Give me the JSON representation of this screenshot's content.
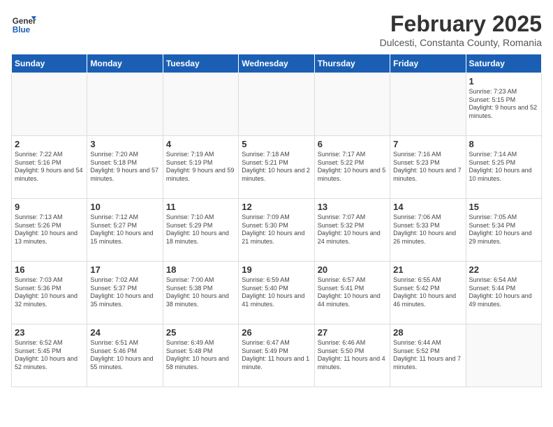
{
  "logo": {
    "general": "General",
    "blue": "Blue"
  },
  "title": "February 2025",
  "subtitle": "Dulcesti, Constanta County, Romania",
  "weekdays": [
    "Sunday",
    "Monday",
    "Tuesday",
    "Wednesday",
    "Thursday",
    "Friday",
    "Saturday"
  ],
  "weeks": [
    [
      {
        "day": "",
        "info": ""
      },
      {
        "day": "",
        "info": ""
      },
      {
        "day": "",
        "info": ""
      },
      {
        "day": "",
        "info": ""
      },
      {
        "day": "",
        "info": ""
      },
      {
        "day": "",
        "info": ""
      },
      {
        "day": "1",
        "info": "Sunrise: 7:23 AM\nSunset: 5:15 PM\nDaylight: 9 hours and 52 minutes."
      }
    ],
    [
      {
        "day": "2",
        "info": "Sunrise: 7:22 AM\nSunset: 5:16 PM\nDaylight: 9 hours and 54 minutes."
      },
      {
        "day": "3",
        "info": "Sunrise: 7:20 AM\nSunset: 5:18 PM\nDaylight: 9 hours and 57 minutes."
      },
      {
        "day": "4",
        "info": "Sunrise: 7:19 AM\nSunset: 5:19 PM\nDaylight: 9 hours and 59 minutes."
      },
      {
        "day": "5",
        "info": "Sunrise: 7:18 AM\nSunset: 5:21 PM\nDaylight: 10 hours and 2 minutes."
      },
      {
        "day": "6",
        "info": "Sunrise: 7:17 AM\nSunset: 5:22 PM\nDaylight: 10 hours and 5 minutes."
      },
      {
        "day": "7",
        "info": "Sunrise: 7:16 AM\nSunset: 5:23 PM\nDaylight: 10 hours and 7 minutes."
      },
      {
        "day": "8",
        "info": "Sunrise: 7:14 AM\nSunset: 5:25 PM\nDaylight: 10 hours and 10 minutes."
      }
    ],
    [
      {
        "day": "9",
        "info": "Sunrise: 7:13 AM\nSunset: 5:26 PM\nDaylight: 10 hours and 13 minutes."
      },
      {
        "day": "10",
        "info": "Sunrise: 7:12 AM\nSunset: 5:27 PM\nDaylight: 10 hours and 15 minutes."
      },
      {
        "day": "11",
        "info": "Sunrise: 7:10 AM\nSunset: 5:29 PM\nDaylight: 10 hours and 18 minutes."
      },
      {
        "day": "12",
        "info": "Sunrise: 7:09 AM\nSunset: 5:30 PM\nDaylight: 10 hours and 21 minutes."
      },
      {
        "day": "13",
        "info": "Sunrise: 7:07 AM\nSunset: 5:32 PM\nDaylight: 10 hours and 24 minutes."
      },
      {
        "day": "14",
        "info": "Sunrise: 7:06 AM\nSunset: 5:33 PM\nDaylight: 10 hours and 26 minutes."
      },
      {
        "day": "15",
        "info": "Sunrise: 7:05 AM\nSunset: 5:34 PM\nDaylight: 10 hours and 29 minutes."
      }
    ],
    [
      {
        "day": "16",
        "info": "Sunrise: 7:03 AM\nSunset: 5:36 PM\nDaylight: 10 hours and 32 minutes."
      },
      {
        "day": "17",
        "info": "Sunrise: 7:02 AM\nSunset: 5:37 PM\nDaylight: 10 hours and 35 minutes."
      },
      {
        "day": "18",
        "info": "Sunrise: 7:00 AM\nSunset: 5:38 PM\nDaylight: 10 hours and 38 minutes."
      },
      {
        "day": "19",
        "info": "Sunrise: 6:59 AM\nSunset: 5:40 PM\nDaylight: 10 hours and 41 minutes."
      },
      {
        "day": "20",
        "info": "Sunrise: 6:57 AM\nSunset: 5:41 PM\nDaylight: 10 hours and 44 minutes."
      },
      {
        "day": "21",
        "info": "Sunrise: 6:55 AM\nSunset: 5:42 PM\nDaylight: 10 hours and 46 minutes."
      },
      {
        "day": "22",
        "info": "Sunrise: 6:54 AM\nSunset: 5:44 PM\nDaylight: 10 hours and 49 minutes."
      }
    ],
    [
      {
        "day": "23",
        "info": "Sunrise: 6:52 AM\nSunset: 5:45 PM\nDaylight: 10 hours and 52 minutes."
      },
      {
        "day": "24",
        "info": "Sunrise: 6:51 AM\nSunset: 5:46 PM\nDaylight: 10 hours and 55 minutes."
      },
      {
        "day": "25",
        "info": "Sunrise: 6:49 AM\nSunset: 5:48 PM\nDaylight: 10 hours and 58 minutes."
      },
      {
        "day": "26",
        "info": "Sunrise: 6:47 AM\nSunset: 5:49 PM\nDaylight: 11 hours and 1 minute."
      },
      {
        "day": "27",
        "info": "Sunrise: 6:46 AM\nSunset: 5:50 PM\nDaylight: 11 hours and 4 minutes."
      },
      {
        "day": "28",
        "info": "Sunrise: 6:44 AM\nSunset: 5:52 PM\nDaylight: 11 hours and 7 minutes."
      },
      {
        "day": "",
        "info": ""
      }
    ]
  ]
}
